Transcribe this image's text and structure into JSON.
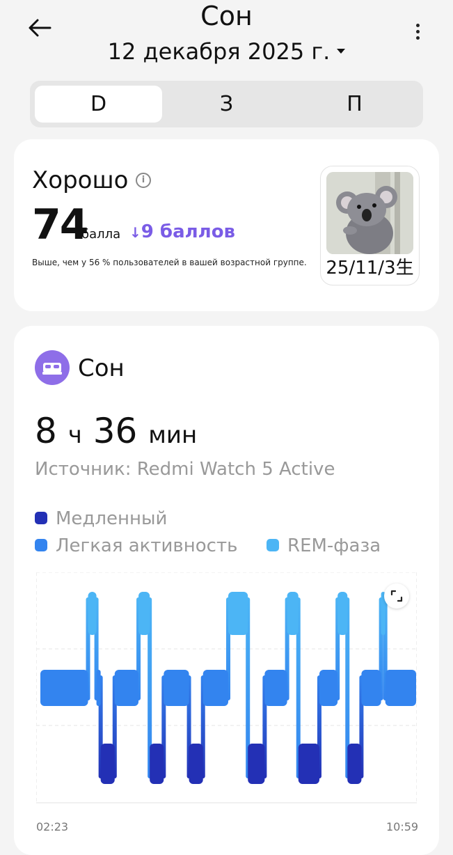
{
  "header": {
    "title": "Сон",
    "date": "12 декабря 2025 г."
  },
  "tabs": [
    {
      "label": "D",
      "active": true
    },
    {
      "label": "З",
      "active": false
    },
    {
      "label": "П",
      "active": false
    }
  ],
  "score": {
    "rating": "Хорошо",
    "value": "74",
    "unit": "балла",
    "delta": "9 баллов",
    "compare": "Выше, чем у 56 % пользователей в вашей возрастной группе."
  },
  "badge": {
    "caption": "25/11/3生"
  },
  "sleep": {
    "title": "Сон",
    "hours": "8",
    "hours_unit": "ч",
    "minutes": "36",
    "minutes_unit": "мин",
    "source": "Источник: Redmi Watch 5 Active"
  },
  "legend": [
    {
      "label": "Медленный",
      "color": "#2330b5"
    },
    {
      "label": "Легкая активность",
      "color": "#3384ef"
    },
    {
      "label": "REM-фаза",
      "color": "#4cb5f5"
    }
  ],
  "chart_data": {
    "type": "bar",
    "x_start": "02:23",
    "x_end": "10:59",
    "stage_order_top_to_bottom": [
      "REM-фаза",
      "Легкая активность",
      "Медленный"
    ],
    "segments": [
      {
        "stage": "Легкая активность",
        "duration": 68
      },
      {
        "stage": "REM-фаза",
        "duration": 12
      },
      {
        "stage": "Легкая активность",
        "duration": 6
      },
      {
        "stage": "Медленный",
        "duration": 20
      },
      {
        "stage": "Легкая активность",
        "duration": 34
      },
      {
        "stage": "REM-фаза",
        "duration": 16
      },
      {
        "stage": "Медленный",
        "duration": 20
      },
      {
        "stage": "Легкая активность",
        "duration": 36
      },
      {
        "stage": "Медленный",
        "duration": 20
      },
      {
        "stage": "Легкая активность",
        "duration": 36
      },
      {
        "stage": "REM-фаза",
        "duration": 28
      },
      {
        "stage": "Медленный",
        "duration": 24
      },
      {
        "stage": "Легкая активность",
        "duration": 32
      },
      {
        "stage": "REM-фаза",
        "duration": 16
      },
      {
        "stage": "Медленный",
        "duration": 30
      },
      {
        "stage": "Легкая активность",
        "duration": 26
      },
      {
        "stage": "REM-фаза",
        "duration": 14
      },
      {
        "stage": "Медленный",
        "duration": 20
      },
      {
        "stage": "Легкая активность",
        "duration": 28
      },
      {
        "stage": "REM-фаза",
        "duration": 6
      },
      {
        "stage": "Легкая активность",
        "duration": 44
      }
    ]
  }
}
